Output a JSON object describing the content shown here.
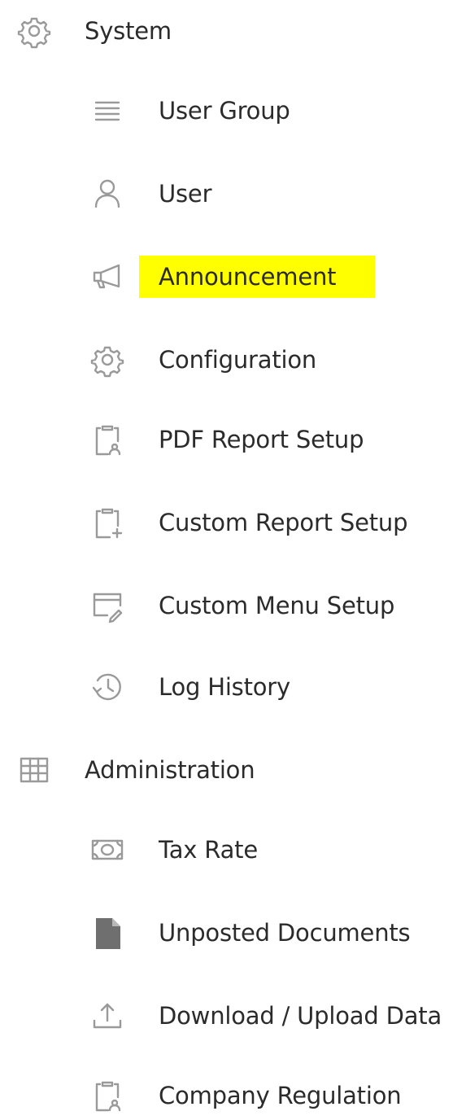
{
  "menu": {
    "system": {
      "label": "System",
      "icon": "gear-icon",
      "items": [
        {
          "label": "User Group",
          "icon": "list-icon"
        },
        {
          "label": "User",
          "icon": "user-icon"
        },
        {
          "label": "Announcement",
          "icon": "megaphone-icon",
          "highlighted": true
        },
        {
          "label": "Configuration",
          "icon": "gear-icon"
        },
        {
          "label": "PDF Report Setup",
          "icon": "clipboard-user-icon"
        },
        {
          "label": "Custom Report Setup",
          "icon": "clipboard-plus-icon"
        },
        {
          "label": "Custom Menu Setup",
          "icon": "window-edit-icon"
        },
        {
          "label": "Log History",
          "icon": "history-icon"
        }
      ]
    },
    "administration": {
      "label": "Administration",
      "icon": "grid-icon",
      "items": [
        {
          "label": "Tax Rate",
          "icon": "money-icon"
        },
        {
          "label": "Unposted Documents",
          "icon": "document-icon"
        },
        {
          "label": "Download / Upload Data",
          "icon": "upload-icon"
        },
        {
          "label": "Company Regulation",
          "icon": "clipboard-user-icon"
        }
      ]
    }
  },
  "colors": {
    "highlight": "#ffff00",
    "text": "#2b2b2b",
    "icon": "#9a9a9a"
  }
}
